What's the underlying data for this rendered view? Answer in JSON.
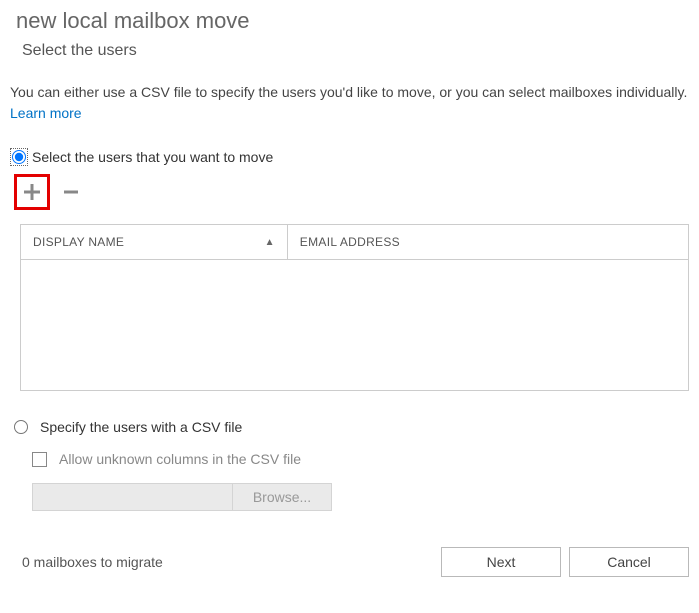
{
  "title": "new local mailbox move",
  "subtitle": "Select the users",
  "description": {
    "text": "You can either use a CSV file to specify the users you'd like to move, or you can select mailboxes individually. ",
    "link": "Learn more"
  },
  "option1": {
    "label": "Select the users that you want to move"
  },
  "table": {
    "columns": {
      "displayName": "DISPLAY NAME",
      "emailAddress": "EMAIL ADDRESS"
    },
    "rows": []
  },
  "option2": {
    "label": "Specify the users with a CSV file"
  },
  "checkbox": {
    "label": "Allow unknown columns in the CSV file"
  },
  "browse": {
    "label": "Browse..."
  },
  "status": "0 mailboxes to migrate",
  "buttons": {
    "next": "Next",
    "cancel": "Cancel"
  }
}
